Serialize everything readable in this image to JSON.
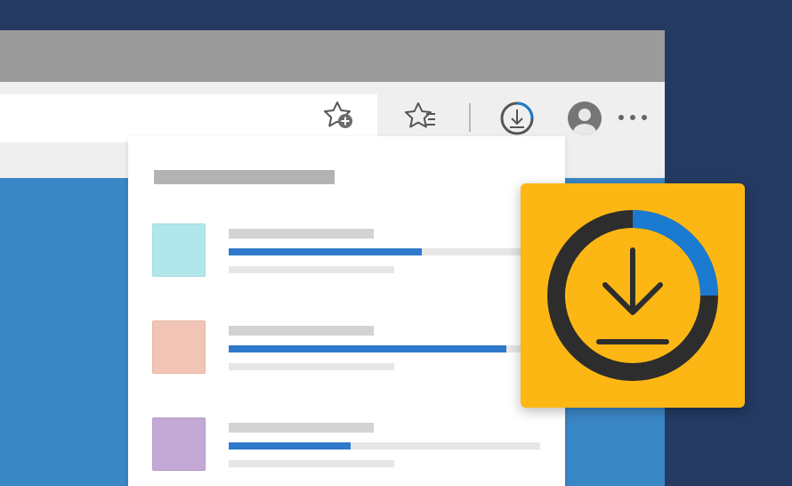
{
  "browser": {
    "toolbar": {
      "icons": [
        "add-favorite-icon",
        "favorites-icon",
        "downloads-icon",
        "profile-icon",
        "more-options-icon"
      ],
      "download_progress": 0.25
    }
  },
  "downloads_panel": {
    "items": [
      {
        "thumb_color": "#b1e7ea",
        "thumb_border": "#a5dde1",
        "progress": 0.62
      },
      {
        "thumb_color": "#f1c5b5",
        "thumb_border": "#e8b8a7",
        "progress": 0.89
      },
      {
        "thumb_color": "#c3a9d5",
        "thumb_border": "#b79ccb",
        "progress": 0.39
      }
    ]
  },
  "hero": {
    "icon": "download-progress-icon",
    "background": "#fdb714",
    "progress": 0.25,
    "accent": "#1a7ad0"
  },
  "colors": {
    "page_bg": "#243a62",
    "content_bg": "#3a87c6",
    "progress_blue": "#2e79cb"
  }
}
